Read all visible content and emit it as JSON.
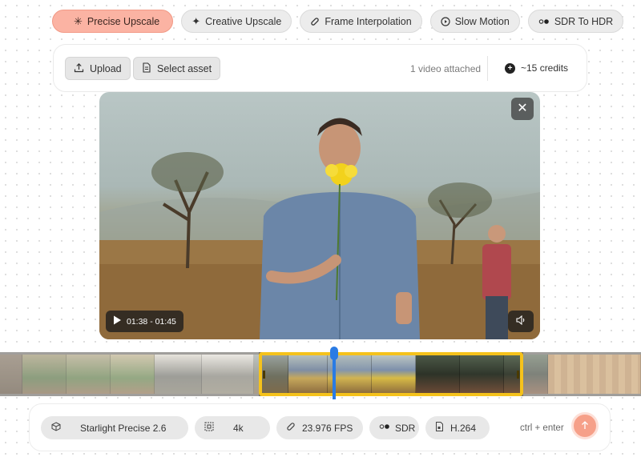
{
  "tabs": [
    {
      "label": "Precise Upscale",
      "icon": "sparkle-asterisk-icon",
      "active": true
    },
    {
      "label": "Creative Upscale",
      "icon": "sparkle-icon",
      "active": false
    },
    {
      "label": "Frame Interpolation",
      "icon": "link-icon",
      "active": false
    },
    {
      "label": "Slow Motion",
      "icon": "play-circle-icon",
      "active": false
    },
    {
      "label": "SDR To HDR",
      "icon": "dots-toggle-icon",
      "active": false
    }
  ],
  "toolbar": {
    "upload_label": "Upload",
    "select_label": "Select asset",
    "attached_text": "1 video attached",
    "credits_text": "~15 credits"
  },
  "player": {
    "time_range": "01:38 - 01:45"
  },
  "settings": {
    "model": "Starlight Precise 2.6",
    "resolution": "4k",
    "fps": "23.976 FPS",
    "dynamic_range": "SDR",
    "codec": "H.264",
    "shortcut_hint": "ctrl + enter"
  },
  "colors": {
    "accent": "#fbb3a3",
    "selection": "#f5c21b",
    "playhead": "#2a7be4"
  }
}
